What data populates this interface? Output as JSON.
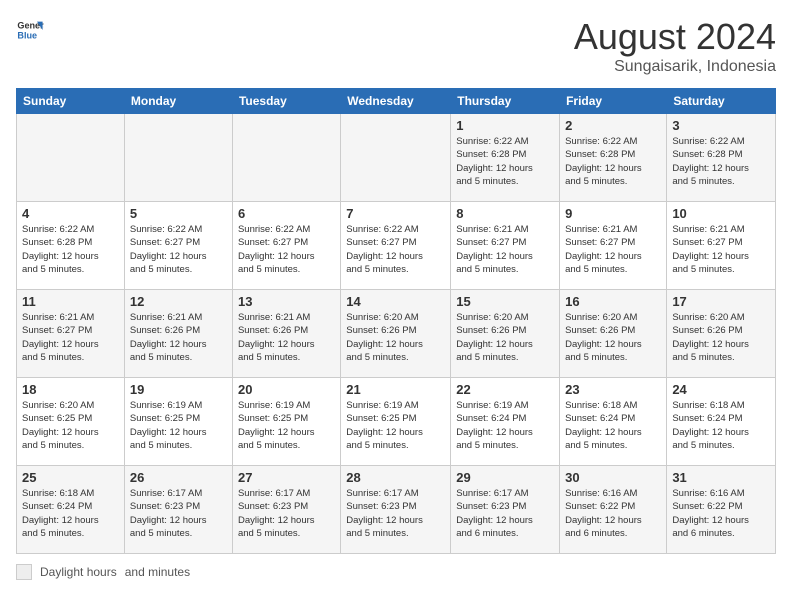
{
  "logo": {
    "line1": "General",
    "line2": "Blue"
  },
  "title": "August 2024",
  "subtitle": "Sungaisarik, Indonesia",
  "days_of_week": [
    "Sunday",
    "Monday",
    "Tuesday",
    "Wednesday",
    "Thursday",
    "Friday",
    "Saturday"
  ],
  "footer": {
    "label1": "Daylight hours",
    "label2": "and minutes"
  },
  "weeks": [
    [
      {
        "day": "",
        "sunrise": "",
        "sunset": "",
        "daylight": ""
      },
      {
        "day": "",
        "sunrise": "",
        "sunset": "",
        "daylight": ""
      },
      {
        "day": "",
        "sunrise": "",
        "sunset": "",
        "daylight": ""
      },
      {
        "day": "",
        "sunrise": "",
        "sunset": "",
        "daylight": ""
      },
      {
        "day": "1",
        "sunrise": "6:22 AM",
        "sunset": "6:28 PM",
        "hours": "12 hours",
        "minutes": "and 5 minutes."
      },
      {
        "day": "2",
        "sunrise": "6:22 AM",
        "sunset": "6:28 PM",
        "hours": "12 hours",
        "minutes": "and 5 minutes."
      },
      {
        "day": "3",
        "sunrise": "6:22 AM",
        "sunset": "6:28 PM",
        "hours": "12 hours",
        "minutes": "and 5 minutes."
      }
    ],
    [
      {
        "day": "4",
        "sunrise": "6:22 AM",
        "sunset": "6:28 PM",
        "hours": "12 hours",
        "minutes": "and 5 minutes."
      },
      {
        "day": "5",
        "sunrise": "6:22 AM",
        "sunset": "6:27 PM",
        "hours": "12 hours",
        "minutes": "and 5 minutes."
      },
      {
        "day": "6",
        "sunrise": "6:22 AM",
        "sunset": "6:27 PM",
        "hours": "12 hours",
        "minutes": "and 5 minutes."
      },
      {
        "day": "7",
        "sunrise": "6:22 AM",
        "sunset": "6:27 PM",
        "hours": "12 hours",
        "minutes": "and 5 minutes."
      },
      {
        "day": "8",
        "sunrise": "6:21 AM",
        "sunset": "6:27 PM",
        "hours": "12 hours",
        "minutes": "and 5 minutes."
      },
      {
        "day": "9",
        "sunrise": "6:21 AM",
        "sunset": "6:27 PM",
        "hours": "12 hours",
        "minutes": "and 5 minutes."
      },
      {
        "day": "10",
        "sunrise": "6:21 AM",
        "sunset": "6:27 PM",
        "hours": "12 hours",
        "minutes": "and 5 minutes."
      }
    ],
    [
      {
        "day": "11",
        "sunrise": "6:21 AM",
        "sunset": "6:27 PM",
        "hours": "12 hours",
        "minutes": "and 5 minutes."
      },
      {
        "day": "12",
        "sunrise": "6:21 AM",
        "sunset": "6:26 PM",
        "hours": "12 hours",
        "minutes": "and 5 minutes."
      },
      {
        "day": "13",
        "sunrise": "6:21 AM",
        "sunset": "6:26 PM",
        "hours": "12 hours",
        "minutes": "and 5 minutes."
      },
      {
        "day": "14",
        "sunrise": "6:20 AM",
        "sunset": "6:26 PM",
        "hours": "12 hours",
        "minutes": "and 5 minutes."
      },
      {
        "day": "15",
        "sunrise": "6:20 AM",
        "sunset": "6:26 PM",
        "hours": "12 hours",
        "minutes": "and 5 minutes."
      },
      {
        "day": "16",
        "sunrise": "6:20 AM",
        "sunset": "6:26 PM",
        "hours": "12 hours",
        "minutes": "and 5 minutes."
      },
      {
        "day": "17",
        "sunrise": "6:20 AM",
        "sunset": "6:26 PM",
        "hours": "12 hours",
        "minutes": "and 5 minutes."
      }
    ],
    [
      {
        "day": "18",
        "sunrise": "6:20 AM",
        "sunset": "6:25 PM",
        "hours": "12 hours",
        "minutes": "and 5 minutes."
      },
      {
        "day": "19",
        "sunrise": "6:19 AM",
        "sunset": "6:25 PM",
        "hours": "12 hours",
        "minutes": "and 5 minutes."
      },
      {
        "day": "20",
        "sunrise": "6:19 AM",
        "sunset": "6:25 PM",
        "hours": "12 hours",
        "minutes": "and 5 minutes."
      },
      {
        "day": "21",
        "sunrise": "6:19 AM",
        "sunset": "6:25 PM",
        "hours": "12 hours",
        "minutes": "and 5 minutes."
      },
      {
        "day": "22",
        "sunrise": "6:19 AM",
        "sunset": "6:24 PM",
        "hours": "12 hours",
        "minutes": "and 5 minutes."
      },
      {
        "day": "23",
        "sunrise": "6:18 AM",
        "sunset": "6:24 PM",
        "hours": "12 hours",
        "minutes": "and 5 minutes."
      },
      {
        "day": "24",
        "sunrise": "6:18 AM",
        "sunset": "6:24 PM",
        "hours": "12 hours",
        "minutes": "and 5 minutes."
      }
    ],
    [
      {
        "day": "25",
        "sunrise": "6:18 AM",
        "sunset": "6:24 PM",
        "hours": "12 hours",
        "minutes": "and 5 minutes."
      },
      {
        "day": "26",
        "sunrise": "6:17 AM",
        "sunset": "6:23 PM",
        "hours": "12 hours",
        "minutes": "and 5 minutes."
      },
      {
        "day": "27",
        "sunrise": "6:17 AM",
        "sunset": "6:23 PM",
        "hours": "12 hours",
        "minutes": "and 5 minutes."
      },
      {
        "day": "28",
        "sunrise": "6:17 AM",
        "sunset": "6:23 PM",
        "hours": "12 hours",
        "minutes": "and 5 minutes."
      },
      {
        "day": "29",
        "sunrise": "6:17 AM",
        "sunset": "6:23 PM",
        "hours": "12 hours",
        "minutes": "and 6 minutes."
      },
      {
        "day": "30",
        "sunrise": "6:16 AM",
        "sunset": "6:22 PM",
        "hours": "12 hours",
        "minutes": "and 6 minutes."
      },
      {
        "day": "31",
        "sunrise": "6:16 AM",
        "sunset": "6:22 PM",
        "hours": "12 hours",
        "minutes": "and 6 minutes."
      }
    ]
  ]
}
